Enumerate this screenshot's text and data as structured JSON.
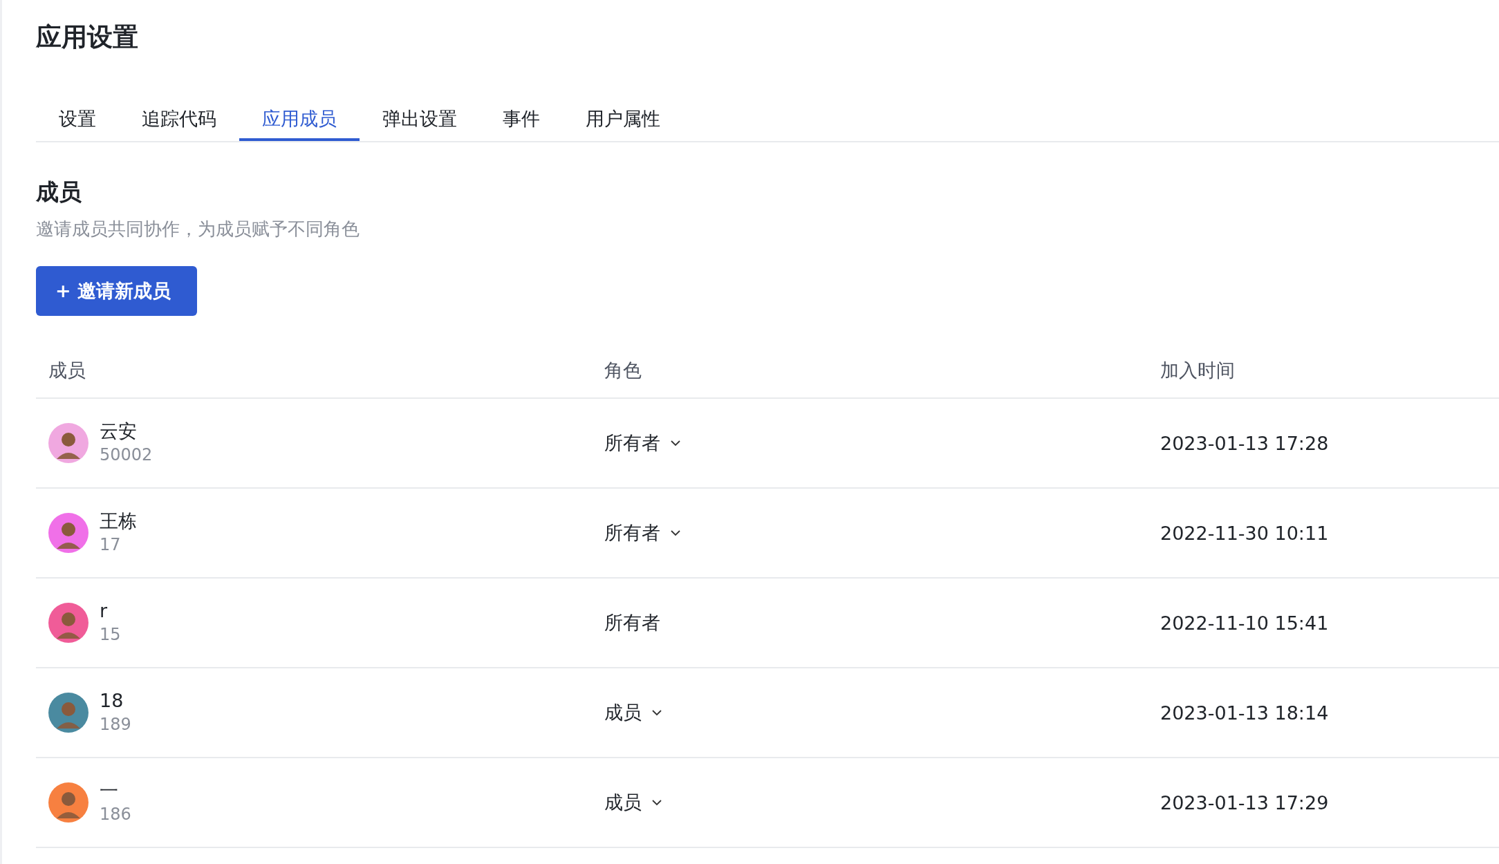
{
  "page": {
    "title": "应用设置"
  },
  "tabs": [
    {
      "label": "设置",
      "selected": false
    },
    {
      "label": "追踪代码",
      "selected": false
    },
    {
      "label": "应用成员",
      "selected": true
    },
    {
      "label": "弹出设置",
      "selected": false
    },
    {
      "label": "事件",
      "selected": false
    },
    {
      "label": "用户属性",
      "selected": false
    }
  ],
  "section": {
    "title": "成员",
    "description": "邀请成员共同协作，为成员赋予不同角色",
    "invite_button": "+ 邀请新成员"
  },
  "table": {
    "columns": [
      "成员",
      "角色",
      "加入时间"
    ],
    "rows": [
      {
        "name": "云安",
        "phone": "50002",
        "color": "#f0a8e0",
        "role": "所有者",
        "dropdown": true,
        "joined": "2023-01-13 17:28"
      },
      {
        "name": "王栋",
        "phone": "17",
        "color": "#f070e8",
        "role": "所有者",
        "dropdown": true,
        "joined": "2022-11-30 10:11"
      },
      {
        "name": "r",
        "phone": "15",
        "color": "#f05c98",
        "role": "所有者",
        "dropdown": false,
        "joined": "2022-11-10 15:41"
      },
      {
        "name": "18",
        "phone": "189",
        "color": "#4a8aa0",
        "role": "成员",
        "dropdown": true,
        "joined": "2023-01-13 18:14"
      },
      {
        "name": "一",
        "phone": "186",
        "color": "#f78040",
        "role": "成员",
        "dropdown": true,
        "joined": "2023-01-13 17:29"
      }
    ]
  }
}
